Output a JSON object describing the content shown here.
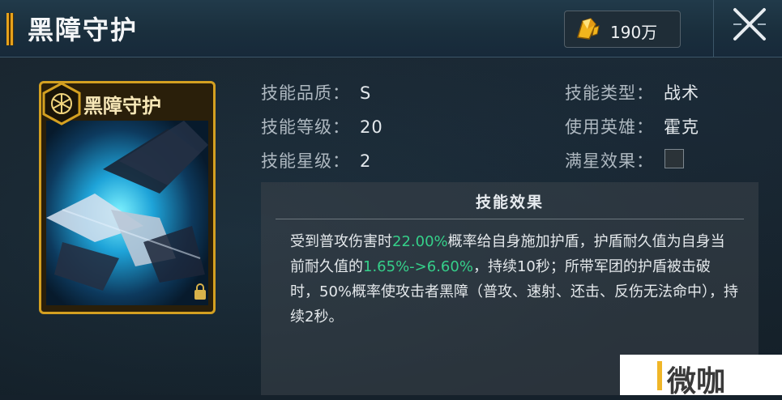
{
  "header": {
    "title": "黑障守护",
    "currency_icon": "gold-crystal-icon",
    "currency_amount": "190万",
    "close_icon": "close-icon"
  },
  "card": {
    "name": "黑障守护",
    "emblem_icon": "hexagon-emblem-icon",
    "lock_icon": "lock-icon"
  },
  "info": {
    "quality_label": "技能品质：",
    "quality_value": "S",
    "level_label": "技能等级：",
    "level_value": "20",
    "star_label": "技能星级：",
    "star_value": "2",
    "type_label": "技能类型：",
    "type_value": "战术",
    "hero_label": "使用英雄：",
    "hero_value": "霍克",
    "fullstar_label": "满星效果：",
    "fullstar_checked": false
  },
  "effect": {
    "title": "技能效果",
    "text_1": "受到普攻伤害时",
    "chance": "22.00%",
    "text_2": "概率给自身施加护盾，护盾耐久值为自身当前耐久值的",
    "shield_range": "1.65%->6.60%",
    "text_3": "，持续10秒；所带军团的护盾被击破时，50%概率使攻击者黑障（普攻、速射、还击、反伤无法命中），持续2秒。"
  },
  "watermark": {
    "text": "微咖"
  },
  "colors": {
    "accent_gold": "#d4a021",
    "highlight_green": "#35d08a"
  }
}
